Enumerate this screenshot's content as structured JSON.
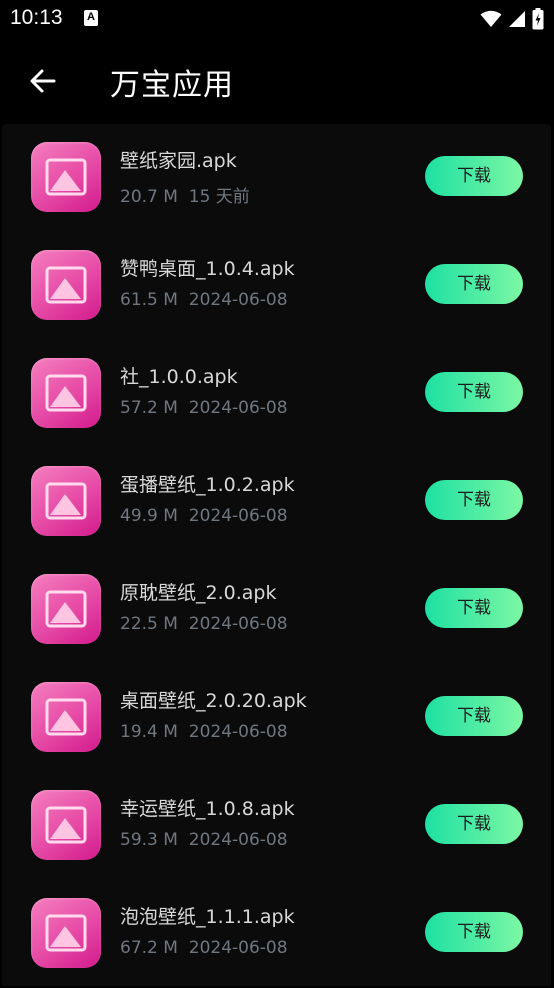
{
  "status_bar": {
    "time": "10:13",
    "notification_icon_letter": "A",
    "icons": [
      "wifi-icon",
      "signal-icon",
      "battery-charging-icon"
    ]
  },
  "header": {
    "title": "万宝应用",
    "back_icon": "back-arrow-icon"
  },
  "colors": {
    "background": "#000000",
    "panel": "#0b0b0b",
    "icon_gradient_start": "#f57fbf",
    "icon_gradient_end": "#d21a8c",
    "button_gradient_start": "#1ee0a3",
    "button_gradient_end": "#7cf7a4",
    "meta_text": "#6f7780"
  },
  "files": [
    {
      "name": "壁纸家园.apk",
      "size": "20.7 M",
      "date": "15 天前",
      "button": "下载",
      "icon": "image-placeholder-icon"
    },
    {
      "name": "赞鸭桌面_1.0.4.apk",
      "size": "61.5 M",
      "date": "2024-06-08",
      "button": "下载",
      "icon": "image-placeholder-icon"
    },
    {
      "name": "社_1.0.0.apk",
      "size": "57.2 M",
      "date": "2024-06-08",
      "button": "下载",
      "icon": "image-placeholder-icon"
    },
    {
      "name": "蛋播壁纸_1.0.2.apk",
      "size": "49.9 M",
      "date": "2024-06-08",
      "button": "下载",
      "icon": "image-placeholder-icon"
    },
    {
      "name": "原耽壁纸_2.0.apk",
      "size": "22.5 M",
      "date": "2024-06-08",
      "button": "下载",
      "icon": "image-placeholder-icon"
    },
    {
      "name": "桌面壁纸_2.0.20.apk",
      "size": "19.4 M",
      "date": "2024-06-08",
      "button": "下载",
      "icon": "image-placeholder-icon"
    },
    {
      "name": "幸运壁纸_1.0.8.apk",
      "size": "59.3 M",
      "date": "2024-06-08",
      "button": "下载",
      "icon": "image-placeholder-icon"
    },
    {
      "name": "泡泡壁纸_1.1.1.apk",
      "size": "67.2 M",
      "date": "2024-06-08",
      "button": "下载",
      "icon": "image-placeholder-icon"
    }
  ]
}
